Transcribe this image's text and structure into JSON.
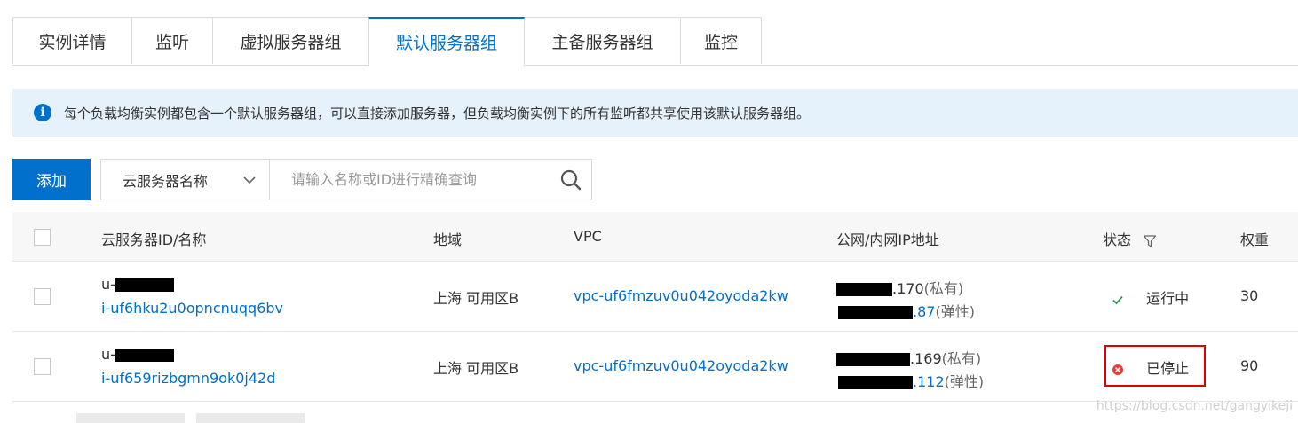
{
  "tabs": [
    {
      "label": "实例详情",
      "active": false
    },
    {
      "label": "监听",
      "active": false
    },
    {
      "label": "虚拟服务器组",
      "active": false
    },
    {
      "label": "默认服务器组",
      "active": true
    },
    {
      "label": "主备服务器组",
      "active": false
    },
    {
      "label": "监控",
      "active": false
    }
  ],
  "info": {
    "icon": "info-icon",
    "text": "每个负载均衡实例都包含一个默认服务器组，可以直接添加服务器，但负载均衡实例下的所有监听都共享使用该默认服务器组。"
  },
  "toolbar": {
    "add_label": "添加",
    "search_select": "云服务器名称",
    "search_placeholder": "请输入名称或ID进行精确查询"
  },
  "table": {
    "headers": {
      "name": "云服务器ID/名称",
      "region": "地域",
      "vpc": "VPC",
      "ip": "公网/内网IP地址",
      "status": "状态",
      "weight": "权重"
    },
    "rows": [
      {
        "name_prefix": "u-",
        "id": "i-uf6hku2u0opncnuqq6bv",
        "region": "上海 可用区B",
        "vpc": "vpc-uf6fmzuv0u042oyoda2kw",
        "ip_private_suffix": ".170",
        "ip_private_tag": "(私有)",
        "ip_elastic_suffix": ".87",
        "ip_elastic_tag": "(弹性)",
        "status": "运行中",
        "status_icon": "check-icon",
        "weight": "30"
      },
      {
        "name_prefix": "u-",
        "id": "i-uf659rizbgmn9ok0j42d",
        "region": "上海 可用区B",
        "vpc": "vpc-uf6fmzuv0u042oyoda2kw",
        "ip_private_suffix": ".169",
        "ip_private_tag": "(私有)",
        "ip_elastic_suffix": ".112",
        "ip_elastic_tag": "(弹性)",
        "status": "已停止",
        "status_icon": "error-icon",
        "weight": "90"
      }
    ]
  },
  "watermark": "https://blog.csdn.net/gangyikeji",
  "colors": {
    "primary": "#0070cc",
    "info_bg": "#e5f1fb",
    "success": "#2e9b4f",
    "error": "#e63c3c",
    "highlight": "#e00000"
  }
}
